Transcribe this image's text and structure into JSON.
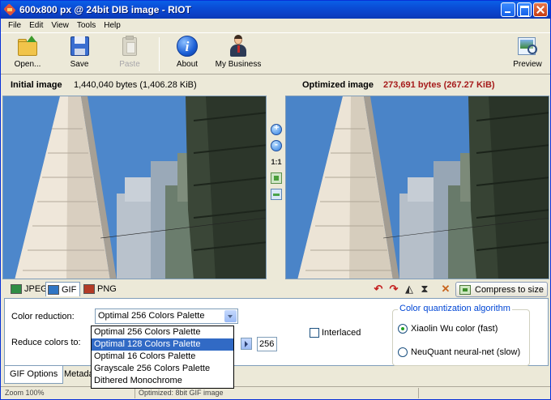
{
  "window": {
    "title": "600x800 px @ 24bit  DIB image - RIOT"
  },
  "menu": [
    "File",
    "Edit",
    "View",
    "Tools",
    "Help"
  ],
  "toolbar": {
    "open": "Open...",
    "save": "Save",
    "paste": "Paste",
    "about": "About",
    "business": "My Business",
    "preview": "Preview"
  },
  "images": {
    "initial_label": "Initial image",
    "initial_size": "1,440,040 bytes (1,406.28 KiB)",
    "optimized_label": "Optimized image",
    "optimized_size": "273,691 bytes (267.27 KiB)"
  },
  "zoom_tools": {
    "actual_size": "1:1"
  },
  "formats": {
    "tabs": [
      "JPEG",
      "GIF",
      "PNG"
    ],
    "active": "GIF",
    "compress_button": "Compress to size"
  },
  "gif_options": {
    "color_reduction_label": "Color reduction:",
    "color_reduction_value": "Optimal 256 Colors Palette",
    "reduce_colors_label": "Reduce colors to:",
    "reduce_colors_value": "256",
    "interlaced_label": "Interlaced",
    "interlaced_checked": false,
    "dropdown_options": [
      "Optimal 256 Colors Palette",
      "Optimal 128 Colors Palette",
      "Optimal 16 Colors Palette",
      "Grayscale 256 Colors Palette",
      "Dithered Monochrome"
    ],
    "dropdown_highlighted": "Optimal 128 Colors Palette",
    "quantization": {
      "title": "Color quantization algorithm",
      "options": [
        "Xiaolin Wu color (fast)",
        "NeuQuant neural-net (slow)"
      ],
      "selected": "Xiaolin Wu color (fast)"
    }
  },
  "bottom_tabs": [
    "GIF Options",
    "Metada"
  ],
  "status": {
    "zoom": "Zoom 100%",
    "optimized": "Optimized: 8bit GIF image"
  },
  "colors": {
    "title_bar": "#0a4cd6",
    "accent_red": "#a61b1b",
    "selection": "#316ac5",
    "sky": "#4a85c9"
  }
}
